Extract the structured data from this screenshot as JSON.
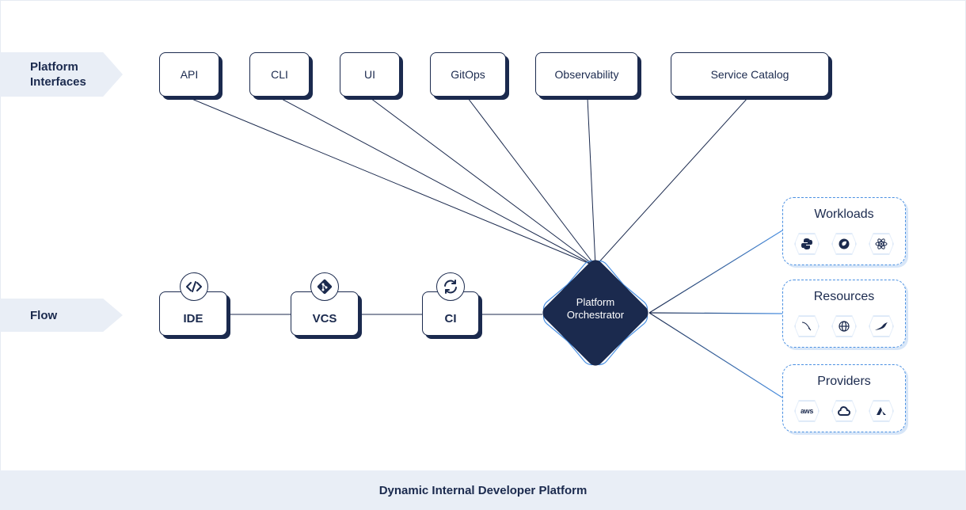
{
  "lanes": {
    "interfaces": "Platform\nInterfaces",
    "flow": "Flow"
  },
  "interfaces": [
    "API",
    "CLI",
    "UI",
    "GitOps",
    "Observability",
    "Service Catalog"
  ],
  "flow": [
    {
      "label": "IDE",
      "icon": "code-icon"
    },
    {
      "label": "VCS",
      "icon": "git-icon"
    },
    {
      "label": "CI",
      "icon": "sync-icon"
    }
  ],
  "orchestrator": "Platform\nOrchestrator",
  "groups": [
    {
      "title": "Workloads",
      "icons": [
        "python-icon",
        "spring-icon",
        "react-icon"
      ]
    },
    {
      "title": "Resources",
      "icons": [
        "mysql-icon",
        "dns-globe-icon",
        "mariadb-icon"
      ]
    },
    {
      "title": "Providers",
      "icons": [
        "aws-icon",
        "google-cloud-icon",
        "azure-icon"
      ],
      "aws_text": "aws"
    }
  ],
  "footer": "Dynamic Internal Developer Platform",
  "colors": {
    "navy": "#1b2a4e",
    "accent": "#4a90e2",
    "lane_bg": "#e9eef6"
  }
}
